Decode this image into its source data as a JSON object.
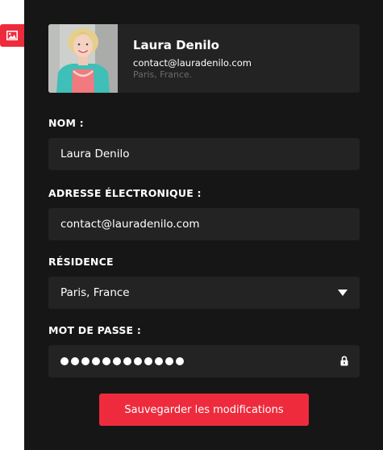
{
  "sidebar": {
    "tab_icon": "image-icon"
  },
  "profile": {
    "name": "Laura Denilo",
    "email": "contact@lauradenilo.com",
    "location": "Paris, France."
  },
  "form": {
    "name_label": "NOM :",
    "name_value": "Laura Denilo",
    "email_label": "ADRESSE ÉLECTRONIQUE :",
    "email_value": "contact@lauradenilo.com",
    "residence_label": "RÉSIDENCE",
    "residence_value": "Paris, France",
    "residence_icon": "chevron-down-icon",
    "password_label": "MOT DE PASSE :",
    "password_length": 12,
    "password_icon": "lock-icon",
    "save_label": "Sauvegarder les modifications"
  },
  "colors": {
    "accent": "#ee2b3d",
    "panel_bg": "#161616",
    "field_bg": "#232323",
    "muted_text": "#6b6b6b"
  }
}
